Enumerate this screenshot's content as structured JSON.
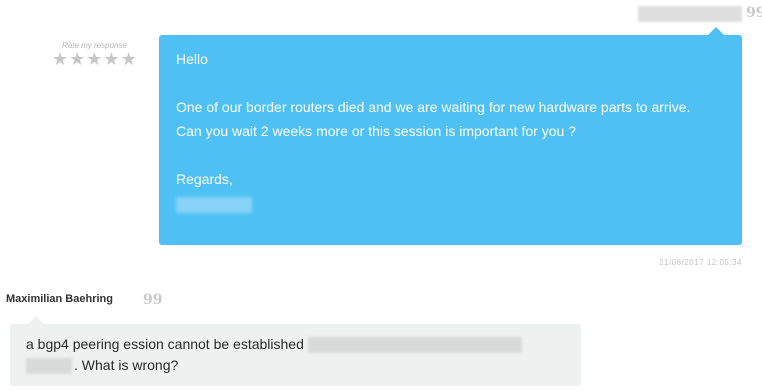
{
  "header": {
    "quote_glyph": "99"
  },
  "rating": {
    "label": "Rate my response",
    "stars": 0,
    "max_stars": 5
  },
  "message_1": {
    "lines": [
      "Hello",
      "One of our border routers died and we are waiting for new hardware parts to arrive.",
      "Can you wait 2 weeks more or this session is important for you ?",
      "Regards,"
    ],
    "timestamp": "21/08/2017 12:05:34"
  },
  "message_2": {
    "author": "Maximilian Baehring",
    "quote_glyph": "99",
    "text_part1": "a bgp4 peering ession cannot be established",
    "text_part2": ". What is wrong?"
  },
  "colors": {
    "agent_bubble": "#4fc0f4",
    "customer_bubble": "#eef1f0"
  }
}
